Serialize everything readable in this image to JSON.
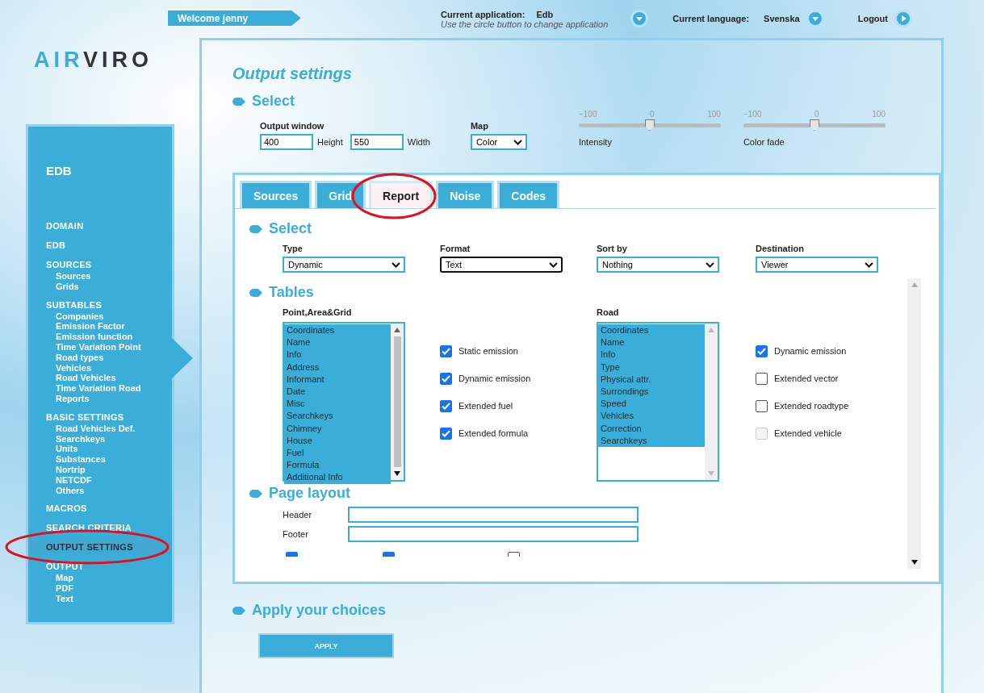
{
  "top_bar": {
    "welcome": "Welcome jenny",
    "app_label": "Current application:",
    "app_value": "Edb",
    "app_hint": "Use the circle button to change application",
    "lang_label": "Current language:",
    "lang_value": "Svenska",
    "logout": "Logout"
  },
  "logo": {
    "part1": "AIR",
    "part2": "VIRO"
  },
  "sidebar": {
    "title": "EDB",
    "groups": [
      {
        "label": "DOMAIN",
        "selected": false
      },
      {
        "label": "EDB",
        "selected": false
      },
      {
        "label": "SOURCES",
        "selected": false,
        "children": [
          "Sources",
          "Grids"
        ]
      },
      {
        "label": "SUBTABLES",
        "selected": false,
        "children": [
          "Companies",
          "Emission Factor",
          "Emission function",
          "Time Variation Point",
          "Road types",
          "Vehicles",
          "Road Vehicles",
          "Time Variation Road",
          "Reports"
        ]
      },
      {
        "label": "BASIC SETTINGS",
        "selected": false,
        "children": [
          "Road Vehicles Def.",
          "Searchkeys",
          "Units",
          "Substances",
          "Nortrip",
          "NETCDF",
          "Others"
        ]
      },
      {
        "label": "MACROS",
        "selected": false
      },
      {
        "label": "SEARCH CRITERIA",
        "selected": false
      },
      {
        "label": "OUTPUT SETTINGS",
        "selected": true
      },
      {
        "label": "OUTPUT",
        "selected": false,
        "children": [
          "Map",
          "PDF",
          "Text"
        ]
      }
    ]
  },
  "page_title": "Output settings",
  "select_section": {
    "heading": "Select",
    "output_window_label": "Output window",
    "height_value": "400",
    "height_label": "Height",
    "width_value": "550",
    "width_label": "Width",
    "map_label": "Map",
    "map_value": "Color",
    "sliders": [
      {
        "min": "−100",
        "mid": "0",
        "max": "100",
        "label": "Intensity",
        "level": 0.5
      },
      {
        "min": "−100",
        "mid": "0",
        "max": "100",
        "label": "Color fade",
        "level": 0.5
      }
    ]
  },
  "tabs": [
    {
      "label": "Sources",
      "selected": false
    },
    {
      "label": "Grid",
      "selected": false
    },
    {
      "label": "Report",
      "selected": true
    },
    {
      "label": "Noise",
      "selected": false
    },
    {
      "label": "Codes",
      "selected": false
    }
  ],
  "report": {
    "select_heading": "Select",
    "dropdowns": [
      {
        "label": "Type",
        "value": "Dynamic",
        "focused": false
      },
      {
        "label": "Format",
        "value": "Text",
        "focused": true
      },
      {
        "label": "Sort by",
        "value": "Nothing",
        "focused": false
      },
      {
        "label": "Destination",
        "value": "Viewer",
        "focused": false
      }
    ],
    "tables_heading": "Tables",
    "tables": [
      {
        "label": "Point,Area&Grid",
        "items": [
          {
            "label": "Coordinates",
            "selected": true
          },
          {
            "label": "Name",
            "selected": true
          },
          {
            "label": "Info",
            "selected": true
          },
          {
            "label": "Address",
            "selected": true
          },
          {
            "label": "Informant",
            "selected": true
          },
          {
            "label": "Date",
            "selected": true
          },
          {
            "label": "Misc",
            "selected": true
          },
          {
            "label": "Searchkeys",
            "selected": true
          },
          {
            "label": "Chimney",
            "selected": true
          },
          {
            "label": "House",
            "selected": true
          },
          {
            "label": "Fuel",
            "selected": true
          },
          {
            "label": "Formula",
            "selected": true
          },
          {
            "label": "Additional Info",
            "selected": true
          }
        ],
        "checkboxes": [
          {
            "label": "Static emission",
            "checked": true,
            "disabled": false
          },
          {
            "label": "Dynamic emission",
            "checked": true,
            "disabled": false
          },
          {
            "label": "Extended fuel",
            "checked": true,
            "disabled": false
          },
          {
            "label": "Extended formula",
            "checked": true,
            "disabled": false
          }
        ]
      },
      {
        "label": "Road",
        "items": [
          {
            "label": "Coordinates",
            "selected": true
          },
          {
            "label": "Name",
            "selected": true
          },
          {
            "label": "Info",
            "selected": true
          },
          {
            "label": "Type",
            "selected": true
          },
          {
            "label": "Physical attr.",
            "selected": true
          },
          {
            "label": "Surrondings",
            "selected": true
          },
          {
            "label": "Speed",
            "selected": true
          },
          {
            "label": "Vehicles",
            "selected": true
          },
          {
            "label": "Correction",
            "selected": true
          },
          {
            "label": "Searchkeys",
            "selected": true
          }
        ],
        "checkboxes": [
          {
            "label": "Dynamic emission",
            "checked": true,
            "disabled": false
          },
          {
            "label": "Extended vector",
            "checked": false,
            "disabled": false
          },
          {
            "label": "Extended roadtype",
            "checked": false,
            "disabled": false
          },
          {
            "label": "Extended vehicle",
            "checked": false,
            "disabled": true
          }
        ]
      }
    ],
    "page_layout_heading": "Page layout",
    "fields": [
      {
        "label": "Header"
      },
      {
        "label": "Footer"
      }
    ],
    "bottom_checkboxes": [
      {
        "checked": true
      },
      {
        "checked": true
      },
      {
        "checked": false
      }
    ]
  },
  "apply": {
    "heading": "Apply your choices",
    "button": "APPLY"
  }
}
